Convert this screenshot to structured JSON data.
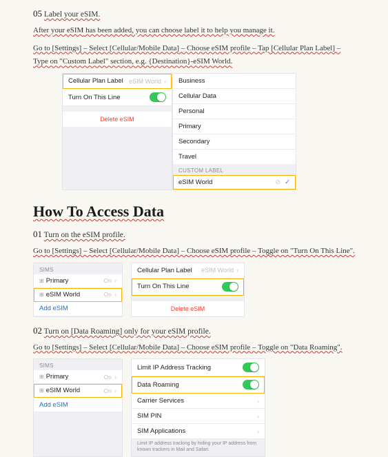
{
  "step05": {
    "num": "05",
    "title": "Label your eSIM.",
    "line1_parts": [
      "After your ",
      "eSIM",
      " has been added, you can choose label it to help you manage it."
    ],
    "line2": "Go to [Settings] – Select [Cellular/Mobile Data] – Choose eSIM profile – Tap [Cellular Plan Label] – Type on \"Custom Label\" section, e.g. {Destination}-eSIM World.",
    "left": {
      "row1_label": "Cellular Plan Label",
      "row1_value": "eSIM World",
      "row2_label": "Turn On This Line",
      "delete": "Delete eSIM"
    },
    "right": {
      "options": [
        "Business",
        "Cellular Data",
        "Personal",
        "Primary",
        "Secondary",
        "Travel"
      ],
      "custom_header": "CUSTOM LABEL",
      "custom_value": "eSIM World"
    }
  },
  "sectionTitle": "How To Access Data",
  "step01": {
    "num": "01",
    "title": "Turn on the eSIM profile.",
    "line": "Go to [Settings] – Select [Cellular/Mobile Data] – Choose eSIM profile – Toggle on \"Turn On This Line\".",
    "sims": {
      "header": "SIMs",
      "rows": [
        {
          "label": "Primary",
          "status": "On"
        },
        {
          "label": "eSIM World",
          "status": "On"
        }
      ],
      "add": "Add eSIM"
    },
    "panel": {
      "row1_label": "Cellular Plan Label",
      "row1_value": "eSIM World",
      "row2_label": "Turn On This Line",
      "delete": "Delete eSIM"
    }
  },
  "step02": {
    "num": "02",
    "title": "Turn on [Data Roaming] only for your eSIM profile.",
    "line": "Go to [Settings] – Select [Cellular/Mobile Data] – Choose eSIM profile – Toggle on \"Data Roaming\".",
    "sims": {
      "header": "SIMs",
      "rows": [
        {
          "label": "Primary",
          "status": "On"
        },
        {
          "label": "eSIM World",
          "status": "On"
        }
      ],
      "add": "Add eSIM"
    },
    "settings": {
      "rows": [
        {
          "label": "Limit IP Address Tracking",
          "type": "toggle"
        },
        {
          "label": "Data Roaming",
          "type": "toggle",
          "hl": true
        },
        {
          "label": "Carrier Services",
          "type": "link"
        },
        {
          "label": "SIM PIN",
          "type": "link"
        },
        {
          "label": "SIM Applications",
          "type": "link"
        }
      ],
      "fineprint": "Limit IP address tracking by hiding your IP address from known trackers in Mail and Safari."
    }
  }
}
